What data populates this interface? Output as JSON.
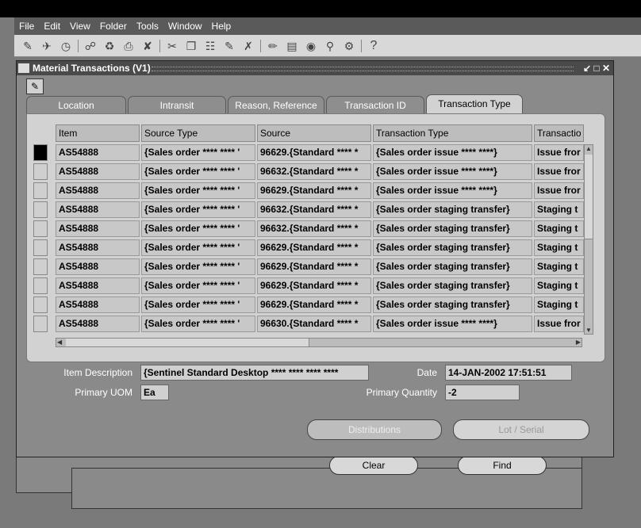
{
  "menu": [
    "File",
    "Edit",
    "View",
    "Folder",
    "Tools",
    "Window",
    "Help"
  ],
  "toolbar_help": "?",
  "window": {
    "title": "Material Transactions (V1)",
    "controls": "↙ □ ✕"
  },
  "tabs": [
    "Location",
    "Intransit",
    "Reason, Reference",
    "Transaction ID",
    "Transaction Type"
  ],
  "columns": [
    "Item",
    "Source Type",
    "Source",
    "Transaction Type",
    "Transactio"
  ],
  "rows": [
    [
      "AS54888",
      "{Sales order **** **** '",
      "96629.{Standard **** *",
      "{Sales order issue **** ****}",
      "Issue fror"
    ],
    [
      "AS54888",
      "{Sales order **** **** '",
      "96632.{Standard **** *",
      "{Sales order issue **** ****}",
      "Issue fror"
    ],
    [
      "AS54888",
      "{Sales order **** **** '",
      "96629.{Standard **** *",
      "{Sales order issue **** ****}",
      "Issue fror"
    ],
    [
      "AS54888",
      "{Sales order **** **** '",
      "96632.{Standard **** *",
      "{Sales order staging transfer}",
      "Staging t"
    ],
    [
      "AS54888",
      "{Sales order **** **** '",
      "96632.{Standard **** *",
      "{Sales order staging transfer}",
      "Staging t"
    ],
    [
      "AS54888",
      "{Sales order **** **** '",
      "96629.{Standard **** *",
      "{Sales order staging transfer}",
      "Staging t"
    ],
    [
      "AS54888",
      "{Sales order **** **** '",
      "96629.{Standard **** *",
      "{Sales order staging transfer}",
      "Staging t"
    ],
    [
      "AS54888",
      "{Sales order **** **** '",
      "96629.{Standard **** *",
      "{Sales order staging transfer}",
      "Staging t"
    ],
    [
      "AS54888",
      "{Sales order **** **** '",
      "96629.{Standard **** *",
      "{Sales order staging transfer}",
      "Staging t"
    ],
    [
      "AS54888",
      "{Sales order **** **** '",
      "96630.{Standard **** *",
      "{Sales order issue **** ****}",
      "Issue fror"
    ]
  ],
  "details": {
    "item_description_label": "Item Description",
    "item_description": "{Sentinel Standard Desktop **** **** **** ****",
    "date_label": "Date",
    "date": "14-JAN-2002 17:51:51",
    "uom_label": "Primary UOM",
    "uom": "Ea",
    "qty_label": "Primary Quantity",
    "qty": "-2"
  },
  "buttons": {
    "distributions": "Distributions",
    "lot_serial": "Lot / Serial",
    "clear": "Clear",
    "find": "Find"
  }
}
